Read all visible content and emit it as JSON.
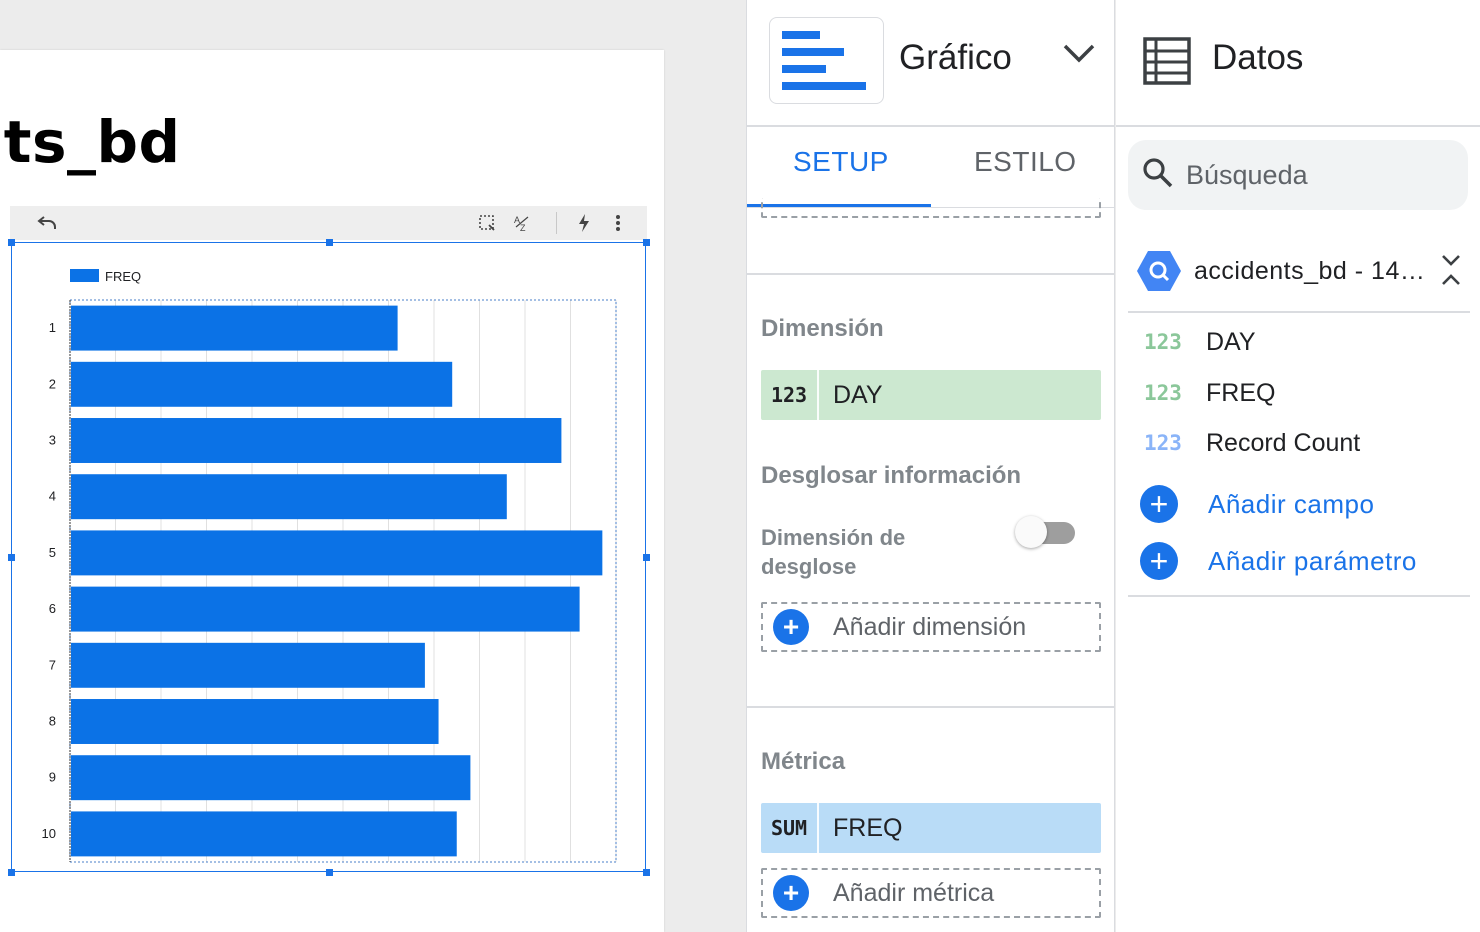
{
  "report": {
    "title_fragment": "nts_bd"
  },
  "chart_toolbar": {
    "undo_icon": "undo-icon",
    "select_icon": "select-area-icon",
    "sort_icon": "sort-az-icon",
    "lightning_icon": "lightning-icon",
    "more_icon": "more-vert-icon"
  },
  "chart_data": {
    "type": "bar",
    "orientation": "horizontal",
    "categories": [
      "1",
      "2",
      "3",
      "4",
      "5",
      "6",
      "7",
      "8",
      "9",
      "10"
    ],
    "series": [
      {
        "name": "FREQ",
        "values": [
          72,
          84,
          108,
          96,
          117,
          112,
          78,
          81,
          88,
          85
        ]
      }
    ],
    "xlim": [
      0,
      120
    ],
    "x_ticks": [
      "0",
      "20",
      "40",
      "60",
      "80",
      "100",
      "120"
    ],
    "grid": true,
    "legend_position": "top-left",
    "colors": {
      "bar": "#0b72e6",
      "grid": "#e0e0e0",
      "axis_text": "#202124"
    }
  },
  "setup_panel": {
    "chart_type_label": "Gráfico",
    "chart_type_icon": "bar-chart-icon",
    "tabs": [
      {
        "label": "SETUP",
        "active": true
      },
      {
        "label": "ESTILO",
        "active": false
      }
    ],
    "dimension": {
      "title": "Dimensión",
      "field": {
        "badge": "123",
        "label": "DAY"
      }
    },
    "drill": {
      "title": "Desglosar información",
      "breakdown_label_line1": "Dimensión de",
      "breakdown_label_line2": "desglose",
      "toggle_on": false,
      "add_label": "Añadir dimensión"
    },
    "metric": {
      "title": "Métrica",
      "field": {
        "badge": "SUM",
        "label": "FREQ"
      },
      "add_label": "Añadir métrica"
    }
  },
  "data_panel": {
    "title": "Datos",
    "search_placeholder": "Búsqueda",
    "source_name": "accidents_bd - 14…",
    "fields": [
      {
        "type": "123",
        "name": "DAY",
        "color": "green"
      },
      {
        "type": "123",
        "name": "FREQ",
        "color": "green"
      },
      {
        "type": "123",
        "name": "Record Count",
        "color": "blue"
      }
    ],
    "add_field_label": "Añadir campo",
    "add_param_label": "Añadir parámetro"
  }
}
